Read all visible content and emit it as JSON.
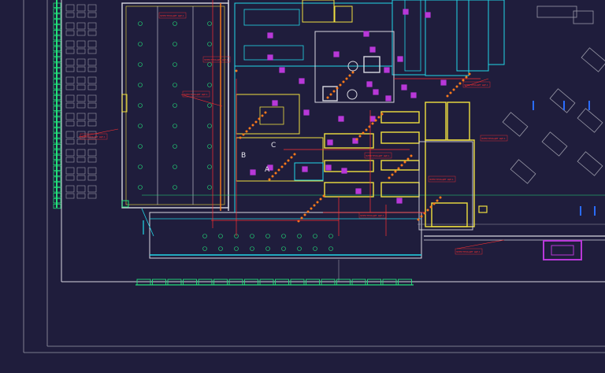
{
  "drawing": {
    "background": "#1f1d3c",
    "colors": {
      "wall": "#d8d8e0",
      "cyan": "#22d8e8",
      "green": "#22e07a",
      "yellow": "#f0e040",
      "red": "#ff3030",
      "orange": "#ff7a1a",
      "purple": "#b838d8",
      "blue": "#2a6cff",
      "grey": "#9a9aa8"
    },
    "zone_labels": [
      "A",
      "B",
      "C"
    ],
    "note_text": "ЭЛЕКТРОЩИТ ЩР-1"
  }
}
